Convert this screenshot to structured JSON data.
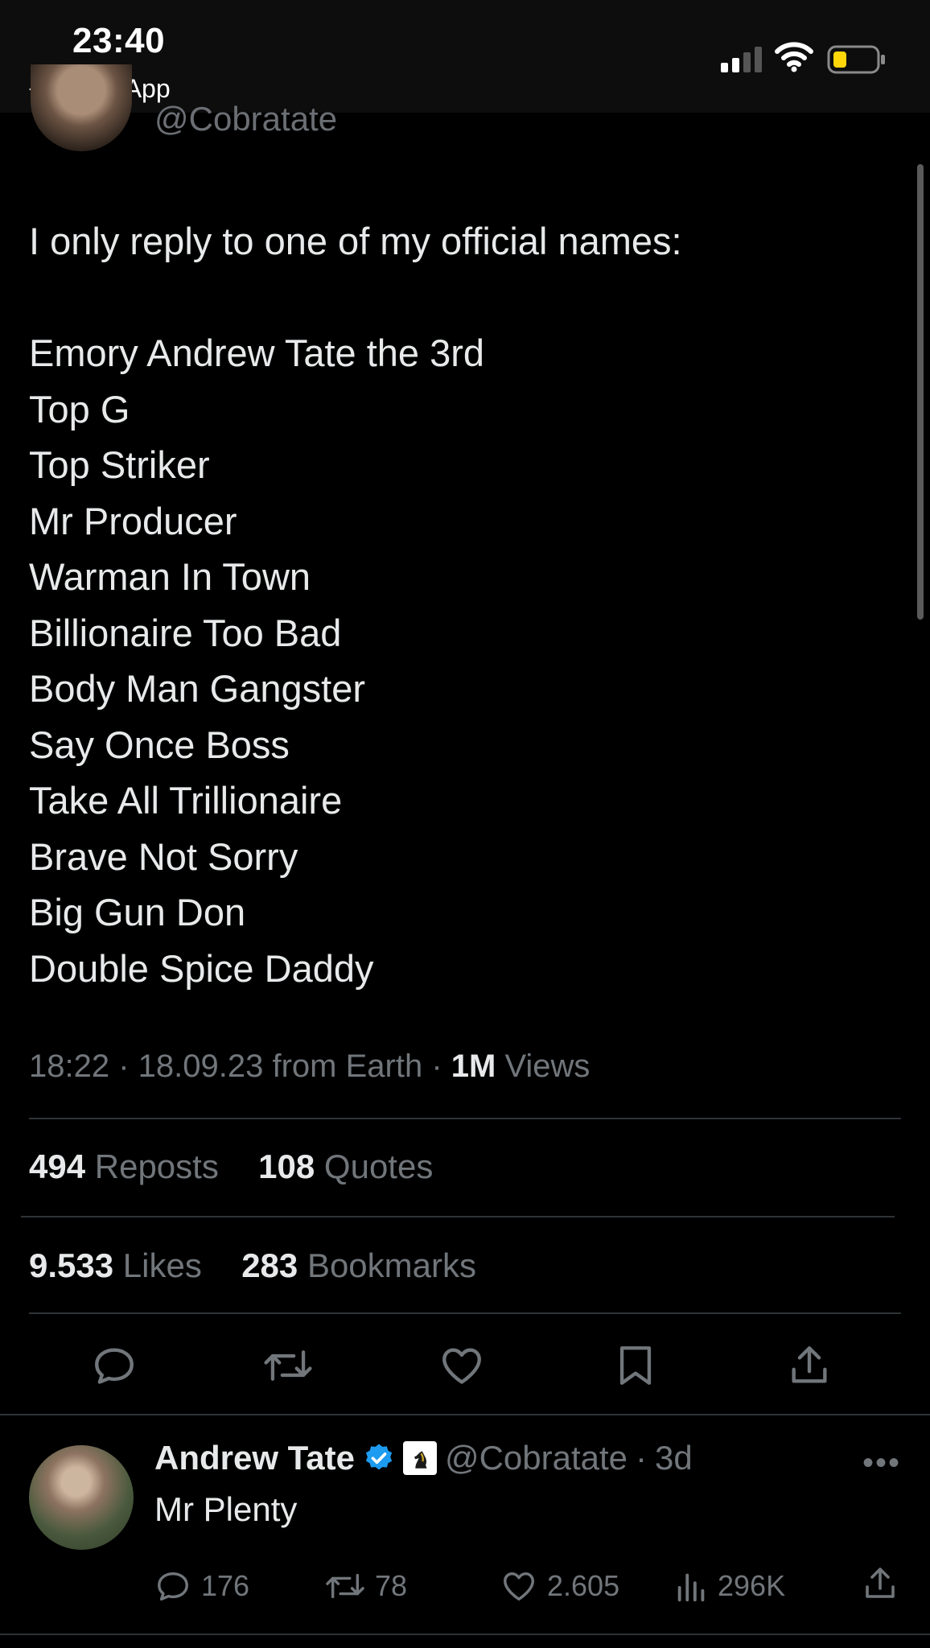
{
  "status_bar": {
    "time": "23:40",
    "back_app": "WhatsApp",
    "icons": [
      "signal-icon",
      "wifi-icon",
      "battery-icon"
    ],
    "battery_color": "#ffd60a"
  },
  "tweet": {
    "handle": "@Cobratate",
    "intro": "I only reply to one of my official names:",
    "names": [
      "Emory Andrew Tate the 3rd",
      "Top G",
      "Top Striker",
      "Mr Producer",
      "Warman In Town",
      "Billionaire Too Bad",
      "Body Man Gangster",
      "Say Once Boss",
      "Take All Trillionaire",
      "Brave Not Sorry",
      "Big Gun Don",
      "Double Spice Daddy"
    ],
    "meta": {
      "time": "18:22",
      "date": "18.09.23",
      "source": "from Earth",
      "views_count": "1M",
      "views_label": "Views"
    },
    "stats": {
      "reposts_count": "494",
      "reposts_label": "Reposts",
      "quotes_count": "108",
      "quotes_label": "Quotes",
      "likes_count": "9.533",
      "likes_label": "Likes",
      "bookmarks_count": "283",
      "bookmarks_label": "Bookmarks"
    },
    "actions": [
      "reply-icon",
      "repost-icon",
      "like-icon",
      "bookmark-icon",
      "share-icon"
    ]
  },
  "reply": {
    "name": "Andrew Tate",
    "handle": "@Cobratate",
    "time_ago": "3d",
    "text": "Mr Plenty",
    "replies": "176",
    "reposts": "78",
    "likes": "2.605",
    "views": "296K",
    "verified_color": "#1d9bf0"
  }
}
